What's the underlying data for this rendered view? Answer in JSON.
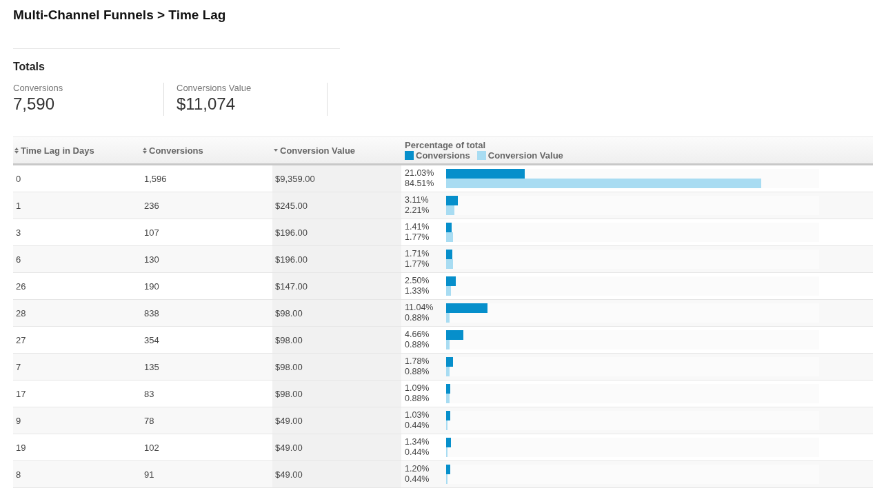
{
  "page_title": "Multi-Channel Funnels > Time Lag",
  "totals": {
    "heading": "Totals",
    "metrics": [
      {
        "label": "Conversions",
        "value": "7,590"
      },
      {
        "label": "Conversions Value",
        "value": "$11,074"
      }
    ]
  },
  "table": {
    "columns": [
      {
        "label": "Time Lag in Days",
        "sorted": false
      },
      {
        "label": "Conversions",
        "sorted": false
      },
      {
        "label": "Conversion Value",
        "sorted": true
      }
    ],
    "chart_header": {
      "title": "Percentage of total",
      "legend": [
        {
          "label": "Conversions",
          "color": "#068fcb"
        },
        {
          "label": "Conversion Value",
          "color": "#a8dcf2"
        }
      ]
    },
    "rows": [
      {
        "cells": [
          "0",
          "1,596",
          "$9,359.00"
        ],
        "bars": [
          {
            "reading": "21.03%",
            "level": 0.2103
          },
          {
            "reading": "84.51%",
            "level": 0.8451
          }
        ]
      },
      {
        "cells": [
          "1",
          "236",
          "$245.00"
        ],
        "bars": [
          {
            "reading": "3.11%",
            "level": 0.0311
          },
          {
            "reading": "2.21%",
            "level": 0.0221
          }
        ]
      },
      {
        "cells": [
          "3",
          "107",
          "$196.00"
        ],
        "bars": [
          {
            "reading": "1.41%",
            "level": 0.0141
          },
          {
            "reading": "1.77%",
            "level": 0.0177
          }
        ]
      },
      {
        "cells": [
          "6",
          "130",
          "$196.00"
        ],
        "bars": [
          {
            "reading": "1.71%",
            "level": 0.0171
          },
          {
            "reading": "1.77%",
            "level": 0.0177
          }
        ]
      },
      {
        "cells": [
          "26",
          "190",
          "$147.00"
        ],
        "bars": [
          {
            "reading": "2.50%",
            "level": 0.025
          },
          {
            "reading": "1.33%",
            "level": 0.0133
          }
        ]
      },
      {
        "cells": [
          "28",
          "838",
          "$98.00"
        ],
        "bars": [
          {
            "reading": "11.04%",
            "level": 0.1104
          },
          {
            "reading": "0.88%",
            "level": 0.0088
          }
        ]
      },
      {
        "cells": [
          "27",
          "354",
          "$98.00"
        ],
        "bars": [
          {
            "reading": "4.66%",
            "level": 0.0466
          },
          {
            "reading": "0.88%",
            "level": 0.0088
          }
        ]
      },
      {
        "cells": [
          "7",
          "135",
          "$98.00"
        ],
        "bars": [
          {
            "reading": "1.78%",
            "level": 0.0178
          },
          {
            "reading": "0.88%",
            "level": 0.0088
          }
        ]
      },
      {
        "cells": [
          "17",
          "83",
          "$98.00"
        ],
        "bars": [
          {
            "reading": "1.09%",
            "level": 0.0109
          },
          {
            "reading": "0.88%",
            "level": 0.0088
          }
        ]
      },
      {
        "cells": [
          "9",
          "78",
          "$49.00"
        ],
        "bars": [
          {
            "reading": "1.03%",
            "level": 0.0103
          },
          {
            "reading": "0.44%",
            "level": 0.0044
          }
        ]
      },
      {
        "cells": [
          "19",
          "102",
          "$49.00"
        ],
        "bars": [
          {
            "reading": "1.34%",
            "level": 0.0134
          },
          {
            "reading": "0.44%",
            "level": 0.0044
          }
        ]
      },
      {
        "cells": [
          "8",
          "91",
          "$49.00"
        ],
        "bars": [
          {
            "reading": "1.20%",
            "level": 0.012
          },
          {
            "reading": "0.44%",
            "level": 0.0044
          }
        ]
      }
    ]
  }
}
